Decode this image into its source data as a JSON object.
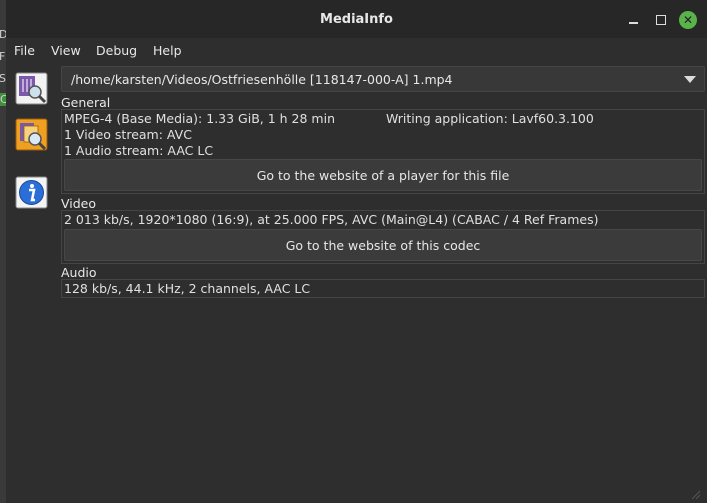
{
  "desktop": {
    "letters": [
      "D",
      "F",
      "S",
      "C"
    ]
  },
  "window": {
    "title": "MediaInfo",
    "close_glyph": "✕"
  },
  "menu": [
    "File",
    "View",
    "Debug",
    "Help"
  ],
  "file_selector": {
    "value": "/home/karsten/Videos/Ostfriesenhölle [118147-000-A] 1.mp4"
  },
  "sidebar": {
    "icons": [
      "basic-view-icon",
      "sheet-view-icon",
      "info-icon"
    ]
  },
  "general": {
    "label": "General",
    "format": "MPEG-4 (Base Media): 1.33 GiB, 1 h 28 min",
    "writing_app": "Writing application: Lavf60.3.100",
    "video_count": "1 Video stream: AVC",
    "audio_count": "1 Audio stream: AAC LC",
    "button": "Go to the website of a player for this file"
  },
  "video": {
    "label": "Video",
    "info": "2 013 kb/s, 1920*1080 (16:9), at 25.000 FPS, AVC (Main@L4) (CABAC / 4 Ref Frames)",
    "button": "Go to the website of this codec"
  },
  "audio": {
    "label": "Audio",
    "info": "128 kb/s, 44.1 kHz, 2 channels, AAC LC"
  },
  "colors": {
    "background": "#2e2e2e",
    "titlebar": "#272727",
    "close_button": "#5ab34a",
    "button": "#3b3b3b",
    "border": "#454545"
  }
}
